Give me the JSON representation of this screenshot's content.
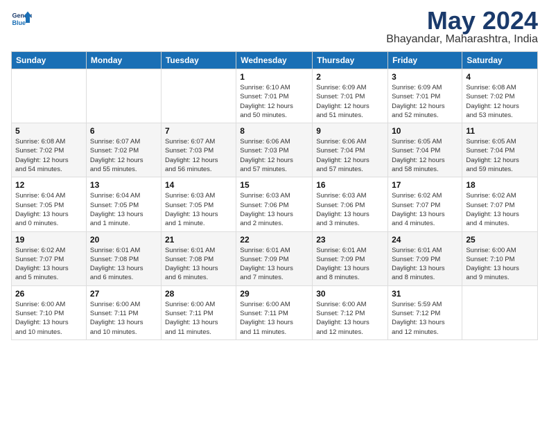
{
  "header": {
    "logo_line1": "General",
    "logo_line2": "Blue",
    "month": "May 2024",
    "location": "Bhayandar, Maharashtra, India"
  },
  "weekdays": [
    "Sunday",
    "Monday",
    "Tuesday",
    "Wednesday",
    "Thursday",
    "Friday",
    "Saturday"
  ],
  "weeks": [
    [
      {
        "day": "",
        "info": ""
      },
      {
        "day": "",
        "info": ""
      },
      {
        "day": "",
        "info": ""
      },
      {
        "day": "1",
        "info": "Sunrise: 6:10 AM\nSunset: 7:01 PM\nDaylight: 12 hours\nand 50 minutes."
      },
      {
        "day": "2",
        "info": "Sunrise: 6:09 AM\nSunset: 7:01 PM\nDaylight: 12 hours\nand 51 minutes."
      },
      {
        "day": "3",
        "info": "Sunrise: 6:09 AM\nSunset: 7:01 PM\nDaylight: 12 hours\nand 52 minutes."
      },
      {
        "day": "4",
        "info": "Sunrise: 6:08 AM\nSunset: 7:02 PM\nDaylight: 12 hours\nand 53 minutes."
      }
    ],
    [
      {
        "day": "5",
        "info": "Sunrise: 6:08 AM\nSunset: 7:02 PM\nDaylight: 12 hours\nand 54 minutes."
      },
      {
        "day": "6",
        "info": "Sunrise: 6:07 AM\nSunset: 7:02 PM\nDaylight: 12 hours\nand 55 minutes."
      },
      {
        "day": "7",
        "info": "Sunrise: 6:07 AM\nSunset: 7:03 PM\nDaylight: 12 hours\nand 56 minutes."
      },
      {
        "day": "8",
        "info": "Sunrise: 6:06 AM\nSunset: 7:03 PM\nDaylight: 12 hours\nand 57 minutes."
      },
      {
        "day": "9",
        "info": "Sunrise: 6:06 AM\nSunset: 7:04 PM\nDaylight: 12 hours\nand 57 minutes."
      },
      {
        "day": "10",
        "info": "Sunrise: 6:05 AM\nSunset: 7:04 PM\nDaylight: 12 hours\nand 58 minutes."
      },
      {
        "day": "11",
        "info": "Sunrise: 6:05 AM\nSunset: 7:04 PM\nDaylight: 12 hours\nand 59 minutes."
      }
    ],
    [
      {
        "day": "12",
        "info": "Sunrise: 6:04 AM\nSunset: 7:05 PM\nDaylight: 13 hours\nand 0 minutes."
      },
      {
        "day": "13",
        "info": "Sunrise: 6:04 AM\nSunset: 7:05 PM\nDaylight: 13 hours\nand 1 minute."
      },
      {
        "day": "14",
        "info": "Sunrise: 6:03 AM\nSunset: 7:05 PM\nDaylight: 13 hours\nand 1 minute."
      },
      {
        "day": "15",
        "info": "Sunrise: 6:03 AM\nSunset: 7:06 PM\nDaylight: 13 hours\nand 2 minutes."
      },
      {
        "day": "16",
        "info": "Sunrise: 6:03 AM\nSunset: 7:06 PM\nDaylight: 13 hours\nand 3 minutes."
      },
      {
        "day": "17",
        "info": "Sunrise: 6:02 AM\nSunset: 7:07 PM\nDaylight: 13 hours\nand 4 minutes."
      },
      {
        "day": "18",
        "info": "Sunrise: 6:02 AM\nSunset: 7:07 PM\nDaylight: 13 hours\nand 4 minutes."
      }
    ],
    [
      {
        "day": "19",
        "info": "Sunrise: 6:02 AM\nSunset: 7:07 PM\nDaylight: 13 hours\nand 5 minutes."
      },
      {
        "day": "20",
        "info": "Sunrise: 6:01 AM\nSunset: 7:08 PM\nDaylight: 13 hours\nand 6 minutes."
      },
      {
        "day": "21",
        "info": "Sunrise: 6:01 AM\nSunset: 7:08 PM\nDaylight: 13 hours\nand 6 minutes."
      },
      {
        "day": "22",
        "info": "Sunrise: 6:01 AM\nSunset: 7:09 PM\nDaylight: 13 hours\nand 7 minutes."
      },
      {
        "day": "23",
        "info": "Sunrise: 6:01 AM\nSunset: 7:09 PM\nDaylight: 13 hours\nand 8 minutes."
      },
      {
        "day": "24",
        "info": "Sunrise: 6:01 AM\nSunset: 7:09 PM\nDaylight: 13 hours\nand 8 minutes."
      },
      {
        "day": "25",
        "info": "Sunrise: 6:00 AM\nSunset: 7:10 PM\nDaylight: 13 hours\nand 9 minutes."
      }
    ],
    [
      {
        "day": "26",
        "info": "Sunrise: 6:00 AM\nSunset: 7:10 PM\nDaylight: 13 hours\nand 10 minutes."
      },
      {
        "day": "27",
        "info": "Sunrise: 6:00 AM\nSunset: 7:11 PM\nDaylight: 13 hours\nand 10 minutes."
      },
      {
        "day": "28",
        "info": "Sunrise: 6:00 AM\nSunset: 7:11 PM\nDaylight: 13 hours\nand 11 minutes."
      },
      {
        "day": "29",
        "info": "Sunrise: 6:00 AM\nSunset: 7:11 PM\nDaylight: 13 hours\nand 11 minutes."
      },
      {
        "day": "30",
        "info": "Sunrise: 6:00 AM\nSunset: 7:12 PM\nDaylight: 13 hours\nand 12 minutes."
      },
      {
        "day": "31",
        "info": "Sunrise: 5:59 AM\nSunset: 7:12 PM\nDaylight: 13 hours\nand 12 minutes."
      },
      {
        "day": "",
        "info": ""
      }
    ]
  ]
}
